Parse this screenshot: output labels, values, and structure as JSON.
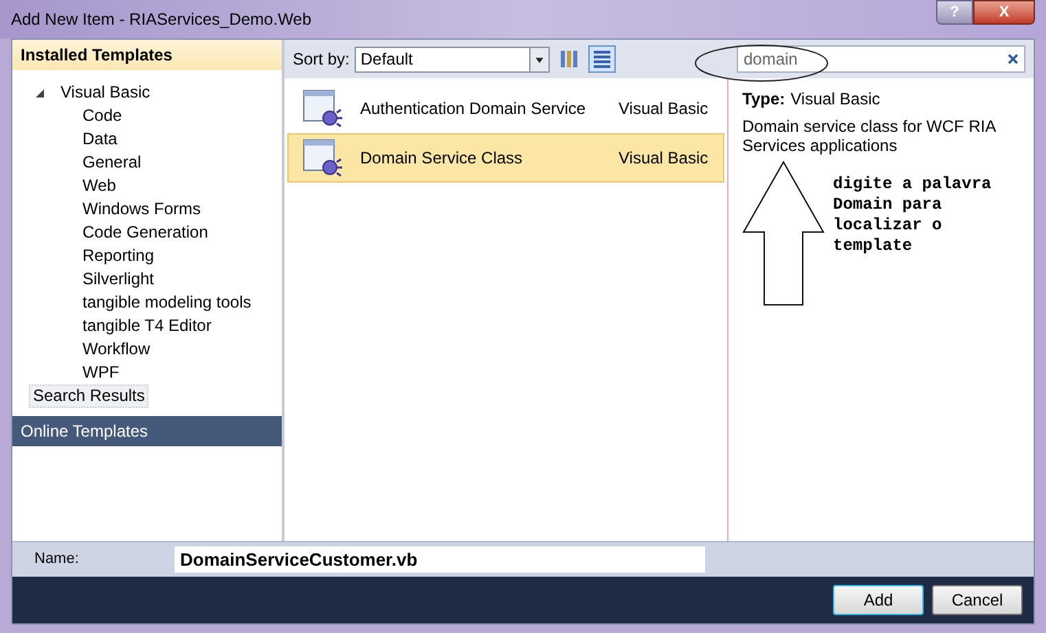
{
  "window": {
    "title": "Add New Item - RIAServices_Demo.Web",
    "buttons": [
      "?",
      "X"
    ]
  },
  "sidebar": {
    "header": "Installed Templates",
    "tree": [
      {
        "label": "Visual Basic",
        "expanded": true,
        "selected": false,
        "children": [
          {
            "label": "Code",
            "selected": false
          },
          {
            "label": "Data",
            "selected": false
          },
          {
            "label": "General",
            "selected": false
          },
          {
            "label": "Web",
            "selected": false
          },
          {
            "label": "Windows Forms",
            "selected": false
          },
          {
            "label": "Code Generation",
            "selected": false
          },
          {
            "label": "Reporting",
            "selected": false
          },
          {
            "label": "Silverlight",
            "selected": false
          },
          {
            "label": "tangible modeling tools",
            "selected": false
          },
          {
            "label": "tangible T4 Editor",
            "selected": false
          },
          {
            "label": "Workflow",
            "selected": false
          },
          {
            "label": "WPF",
            "selected": false
          }
        ]
      },
      {
        "label": "Search Results",
        "selected": true
      }
    ],
    "footer": "Online Templates"
  },
  "toolbar": {
    "sort_label": "Sort by:",
    "sort_value": "Default",
    "views": [
      {
        "kind": "small",
        "selected": false
      },
      {
        "kind": "details",
        "selected": true
      }
    ]
  },
  "search": {
    "value": "domain"
  },
  "templates": [
    {
      "name": "Authentication Domain Service",
      "language": "Visual Basic",
      "selected": false
    },
    {
      "name": "Domain Service Class",
      "language": "Visual Basic",
      "selected": true
    }
  ],
  "details": {
    "type_label": "Type:",
    "type_value": "Visual Basic",
    "description": "Domain service class for WCF RIA Services applications"
  },
  "annotation": {
    "text": "digite a palavra Domain para localizar o template"
  },
  "name_field": {
    "label": "Name:",
    "value": "DomainServiceCustomer.vb"
  },
  "buttons": [
    {
      "label": "Add",
      "default": true
    },
    {
      "label": "Cancel",
      "default": false
    }
  ]
}
